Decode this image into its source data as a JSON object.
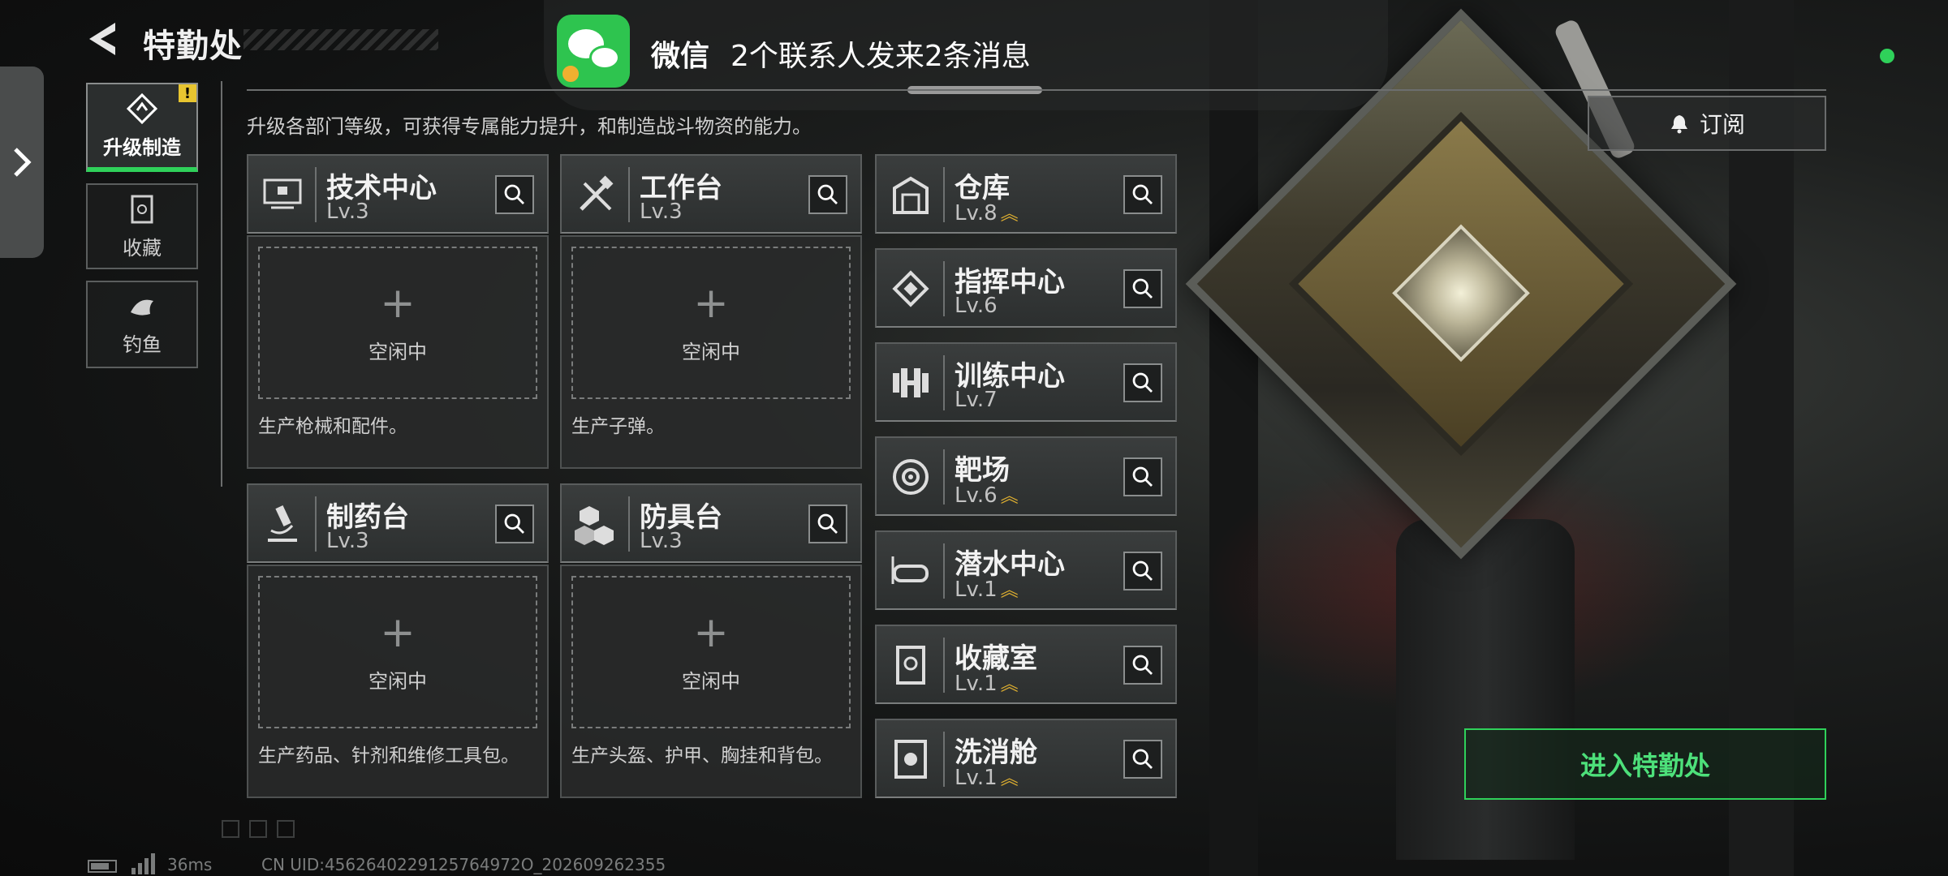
{
  "header": {
    "title": "特勤处"
  },
  "notification": {
    "app": "微信",
    "message": "2个联系人发来2条消息"
  },
  "sidebar": {
    "tabs": [
      {
        "label": "升级制造",
        "badge": "!"
      },
      {
        "label": "收藏"
      },
      {
        "label": "钓鱼"
      }
    ]
  },
  "main": {
    "description": "升级各部门等级，可获得专属能力提升，和制造战斗物资的能力。",
    "subscribe_label": "订阅",
    "big_cards": [
      {
        "name": "技术中心",
        "level": "Lv.3",
        "slot_label": "空闲中",
        "slot_plus": "+",
        "desc": "生产枪械和配件。"
      },
      {
        "name": "工作台",
        "level": "Lv.3",
        "slot_label": "空闲中",
        "slot_plus": "+",
        "desc": "生产子弹。"
      },
      {
        "name": "制药台",
        "level": "Lv.3",
        "slot_label": "空闲中",
        "slot_plus": "+",
        "desc": "生产药品、针剂和维修工具包。"
      },
      {
        "name": "防具台",
        "level": "Lv.3",
        "slot_label": "空闲中",
        "slot_plus": "+",
        "desc": "生产头盔、护甲、胸挂和背包。"
      }
    ],
    "small_cards": [
      {
        "name": "仓库",
        "level": "Lv.8",
        "upgrade": true
      },
      {
        "name": "指挥中心",
        "level": "Lv.6",
        "upgrade": false
      },
      {
        "name": "训练中心",
        "level": "Lv.7",
        "upgrade": false
      },
      {
        "name": "靶场",
        "level": "Lv.6",
        "upgrade": true
      },
      {
        "name": "潜水中心",
        "level": "Lv.1",
        "upgrade": true
      },
      {
        "name": "收藏室",
        "level": "Lv.1",
        "upgrade": true
      },
      {
        "name": "洗消舱",
        "level": "Lv.1",
        "upgrade": true
      }
    ],
    "enter_button": "进入特勤处"
  },
  "footer": {
    "ping": "36ms",
    "uid": "CN UID:4562640229125764972O_202609262355"
  },
  "colors": {
    "accent": "#2fd15a",
    "upgrade": "#e0b030",
    "wechat": "#2ec44f"
  }
}
